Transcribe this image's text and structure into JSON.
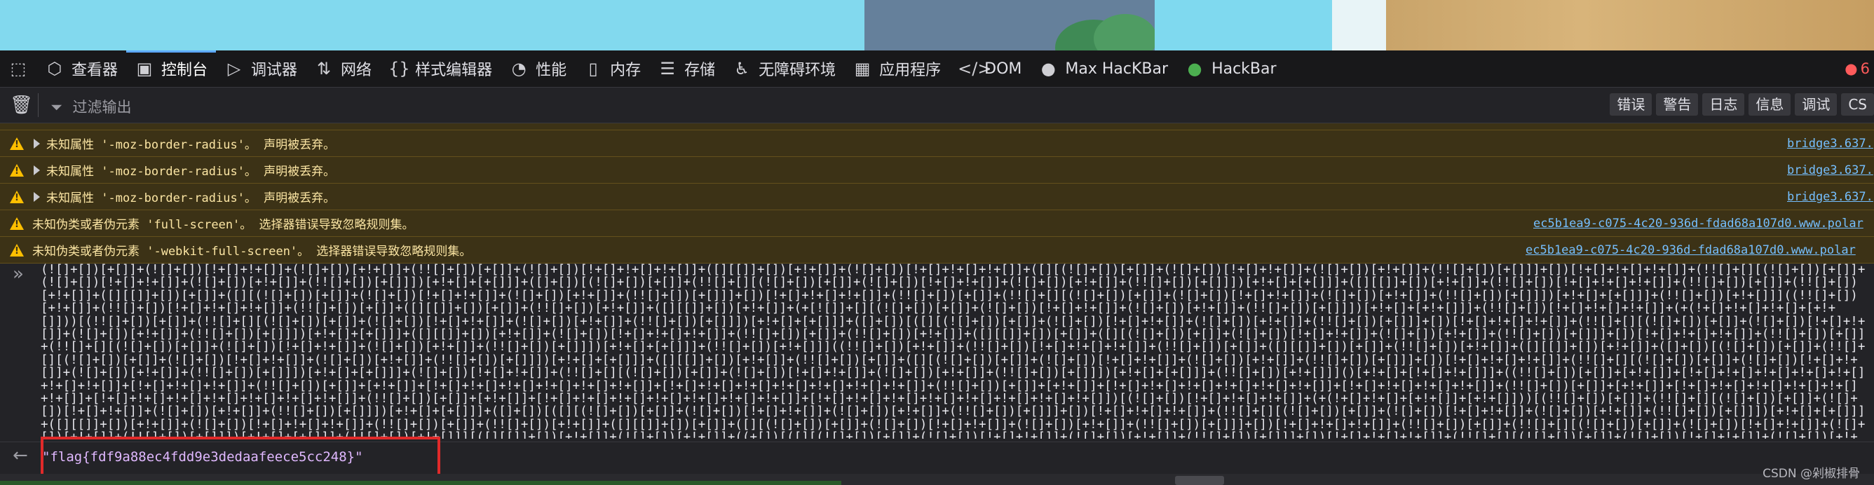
{
  "toolbar": {
    "tabs": [
      {
        "label": "查看器",
        "icon": "inspector-icon"
      },
      {
        "label": "控制台",
        "icon": "console-icon"
      },
      {
        "label": "调试器",
        "icon": "debugger-icon"
      },
      {
        "label": "网络",
        "icon": "network-icon"
      },
      {
        "label": "样式编辑器",
        "icon": "style-editor-icon"
      },
      {
        "label": "性能",
        "icon": "performance-icon"
      },
      {
        "label": "内存",
        "icon": "memory-icon"
      },
      {
        "label": "存储",
        "icon": "storage-icon"
      },
      {
        "label": "无障碍环境",
        "icon": "accessibility-icon"
      },
      {
        "label": "应用程序",
        "icon": "application-icon"
      },
      {
        "label": "DOM",
        "icon": "dom-icon"
      },
      {
        "label": "Max HacKBar",
        "icon": "max-hackbar-icon"
      },
      {
        "label": "HackBar",
        "icon": "hackbar-icon"
      }
    ],
    "error_count": "6"
  },
  "filterbar": {
    "placeholder": "过滤输出",
    "buttons": [
      "错误",
      "警告",
      "日志",
      "信息",
      "调试",
      "CS"
    ]
  },
  "messages": [
    {
      "text": "未知属性 '-moz-border-radius'。  声明被丢弃。",
      "source": "bridge3.637.",
      "expandable": true
    },
    {
      "text": "未知属性 '-moz-border-radius'。  声明被丢弃。",
      "source": "bridge3.637.",
      "expandable": true
    },
    {
      "text": "未知属性 '-moz-border-radius'。  声明被丢弃。",
      "source": "bridge3.637.",
      "expandable": true
    },
    {
      "text": "未知伪类或者伪元素 'full-screen'。  选择器错误导致忽略规则集。",
      "source": "ec5b1ea9-c075-4c20-936d-fdad68a107d0.www.polar",
      "expandable": false
    },
    {
      "text": "未知伪类或者伪元素 '-webkit-full-screen'。  选择器错误导致忽略规则集。",
      "source": "ec5b1ea9-c075-4c20-936d-fdad68a107d0.www.polar",
      "expandable": false
    }
  ],
  "input": {
    "prompt": "»",
    "code": "(![]+[])[+[]]+(![]+[])[!+[]+!+[]]+(![]+[])[+!+[]]+(!![]+[])[+[]]+(![]+[])[!+[]+!+[]+!+[]]+([][[]]+[])[+!+[]]+(![]+[])[!+[]+!+[]+!+[]]+([][(![]+[])[+[]]+(![]+[])[!+[]+!+[]]+(![]+[])[+!+[]]+(!![]+[])[+[]]]+[])[!+[]+!+[]+!+[]]+(!![]+[][(![]+[])[+[]]+(![]+[])[!+[]+!+[]]+(![]+[])[+!+[]]+(!![]+[])[+[]]])[+!+[]+[+[]]]+([]+[])[(![]+[])[+[]]+(!![]+[][(![]+[])[+[]]+(![]+[])[!+[]+!+[]]+(![]+[])[+!+[]]+(!![]+[])[+[]]])[+!+[]+[+[]]]+([][[]]+[])[+!+[]]+(!![]+[])[!+[]+!+[]+!+[]]+(!![]+[])[+[]]+(!![]+[])[+!+[]]+([][[]]+[])[+[]]+([][(![]+[])[+[]]+(![]+[])[!+[]+!+[]]+(![]+[])[+!+[]]+(!![]+[])[+[]]]+[])[!+[]+!+[]+!+[]]+(!![]+[])[+[]]+(!![]+[][(![]+[])[+[]]+(![]+[])[!+[]+!+[]]+(![]+[])[+!+[]]+(!![]+[])[+[]]])[+!+[]+[+[]]]+(!![]+[])[+!+[]]]((!![]+[])[+!+[]]+(!![]+[])[!+[]+!+[]+!+[]]+(!![]+[])[+[]]+([][[]]+[])[+[]]+(!![]+[])[+!+[]]+([][[]]+[])[+!+[]]+(+[![]]+[][(![]+[])[+[]]+(![]+[])[!+[]+!+[]]+(![]+[])[+!+[]]+(!![]+[])[+[]]])[+!+[]+[+!+[]]]+(!![]+[])[!+[]+!+[]+!+[]]+(+(!+[]+!+[]+!+[]+[+!+[]]))[(!![]+[])[+[]]+(!![]+[][(![]+[])[+[]]+(![]+[])[!+[]+!+[]]+(![]+[])[+!+[]]+(!![]+[])[+[]]])[+!+[]+[+[]]]+([]+[])[([][(![]+[])[+[]]+(![]+[])[!+[]+!+[]]+(![]+[])[+!+[]]+(!![]+[])[+[]]]+[])[!+[]+!+[]+!+[]]+(!![]+[][(![]+[])[+[]]+(![]+[])[!+[]+!+[]]+(![]+[])[+!+[]]+(!![]+[])[+[]]])[+!+[]+[+[]]]+([][[]]+[])[+!+[]]+(![]+[])[!+[]+!+[]+!+[]]+(!![]+[])[+[]]+(!![]+[])[+!+[]]+([][[]]+[])[+[]]+([][(![]+[])[+[]]+(![]+[])[!+[]+!+[]]+(![]+[])[+!+[]]+(!![]+[])[+[]]]+[])[!+[]+!+[]+!+[]]+(!![]+[])[+[]]+(!![]+[][(![]+[])[+[]]+(![]+[])[!+[]+!+[]]+(![]+[])[+!+[]]+(!![]+[])[+[]]])[+!+[]+[+[]]]+(!![]+[])[+!+[]]]((!![]+[])[+!+[]]+(!![]+[])[!+[]+!+[]+!+[]]+(!![]+[])[+[]]+([][[]]+[])[+[]]+(!![]+[])[+!+[]]+([][[]]+[])[+!+[]]+([]+[])[(![]+[])[+[]]+(!![]+[][(![]+[])[+[]]+(![]+[])[!+[]+!+[]]+(![]+[])[+!+[]]+(!![]+[])[+[]]])[+!+[]+[+[]]]+([][[]]+[])[+!+[]]+(!![]+[])[+[]]+([][(![]+[])[+[]]+(![]+[])[!+[]+!+[]]+(![]+[])[+!+[]]+(!![]+[])[+[]]]+[])[!+[]+!+[]+!+[]]+(!![]+[][(![]+[])[+[]]+(![]+[])[!+[]+!+[]]+(![]+[])[+!+[]]+(!![]+[])[+[]]])[+!+[]+[+[]]]+(![]+[])[!+[]+!+[]]+(!![]+[][(![]+[])[+[]]+(![]+[])[!+[]+!+[]]+(![]+[])[+!+[]]+(!![]+[])[+[]]])[+!+[]+[+[]]]+(!![]+[])[+!+[]]]()[+!+[]+[!+[]+!+[]]]+((!![]+[])[+[]]+[+!+[]]+[!+[]+!+[]+!+[]+!+[]+!+[]+!+[]+!+[]]+[!+[]+!+[]+!+[]]+(!![]+[])[+[]]+[+!+[]]+[!+[]+!+[]+!+[]+!+[]+!+[]+!+[]]+[!+[]+!+[]+!+[]+!+[]+!+[]+!+[]+!+[]]+(!![]+[])[+[]]+[+!+[]]+[!+[]+!+[]+!+[]+!+[]+!+[]+!+[]]+[!+[]+!+[]+!+[]+!+[]]+(!![]+[])[+[]]+[+!+[]]+[!+[]+!+[]+!+[]+!+[]+!+[]+!+[]]+[!+[]+!+[]+!+[]+!+[]+!+[]+!+[]+!+[]]+(!![]+[])[+[]]+[+!+[]]+[!+[]+!+[]+!+[]+!+[]+!+[]+!+[]+!+[]]+[!+[]+!+[]+!+[]+!+[]+!+[]+!+[]+!+[]+!+[]])[(![]+[])[!+[]+!+[]+!+[]]+(+(!+[]+!+[]+[+!+[]]+[+!+[]]))[(!![]+[])[+[]]+(!![]+[][(![]+[])[+[]]+(![]+[])[!+[]+!+[]]+(![]+[])[+!+[]]+(!![]+[])[+[]]])[+!+[]+[+[]]]+([]+[])[([][(![]+[])[+[]]+(![]+[])[!+[]+!+[]]+(![]+[])[+!+[]]+(!![]+[])[+[]]]+[])[!+[]+!+[]+!+[]]+(!![]+[][(![]+[])[+[]]+(![]+[])[!+[]+!+[]]+(![]+[])[+!+[]]+(!![]+[])[+[]]])[+!+[]+[+[]]]+([][[]]+[])[+!+[]]+(![]+[])[!+[]+!+[]+!+[]]+(!![]+[])[+[]]+(!![]+[])[+!+[]]+([][[]]+[])[+[]]+([][(![]+[])[+[]]+(![]+[])[!+[]+!+[]]+(![]+[])[+!+[]]+(!![]+[])[+[]]]+[])[!+[]+!+[]+!+[]]+(!![]+[])[+[]]+(!![]+[][(![]+[])[+[]]+(![]+[])[!+[]+!+[]]+(![]+[])[+!+[]]+(!![]+[])[+[]]])[+!+[]+[+[]]]+(!![]+[])[+!+[]]][([][[]]+[])[+!+[]]+(![]+[])[+!+[]]+((+[])[([][(![]+[])[+[]]+(![]+[])[!+[]+!+[]]+(![]+[])[+!+[]]+(!![]+[])[+[]]]+[])[!+[]+!+[]+!+[]]+(!![]+[][(![]+[])[+[]]+(![]+[])[!+[]+!+[]]+(![]+[])[+!+[]]+(!![]+[])[+[]]])[+!+[]+[+[]]]+([][[]]+[])[+!+[]]+(![]+[])[!+[]+!+[]+!+[]]+(!![]+[])[+[]]+(!![]+[])[+!+[]]+([][[]]+[])[+[]]+([][(![]+[])[+[]]+(![]+[])[!+[]+!+[]]+(![]+[])[+!+[]]+(!![]+[])[+[]]]+[])[!+[]+!+[]+!+[]]+(!![]+[])[+[]]+(!![]+[][(![]+[])[+[]]+(![]+[])[!+[]+!+[]]+(![]+[])[+!+[]]+(!![]+[])[+[]]])[+!+[]+[+[]]]+(!![]+[])[+!+[]]]+[])[+!+[]+[+!+[]]]+(!![]+[])[!+[]+!+[]+!+[]]]](!+[]+!+[]+!+[]+[!+[]+!+[]])+(![]+[])[+!+[]]+(![]+[])[!+[]+!+[]])()((+(+!+[]+[!+[]+!+[]+!+[]+!+[]+!+[]+!+[]+!+[]+!+[]]+[+[]]))+[])[+!+[]]+[!+[]+!+[]]+[!+[]+!+[]+!+[]+!+[]+!+[]+!+[]]+[!+[]+!+[]+!+[]+!+[]+!+[]+!+[]+!+[]+!+[]])+(![]+[])[!+[]+!+[]]+[+!+[]]+[!+[]+!+[]+!+[]]+[+!+[]]+[!+[]+!+[]+!+[]+!+[]+!+[]+!+[]+!+[]]"
  },
  "result": {
    "arrow": "←",
    "value": "\"flag{fdf9a88ec4fdd9e3dedaafeece5cc248}\""
  },
  "watermark": "CSDN @剁椒排骨"
}
